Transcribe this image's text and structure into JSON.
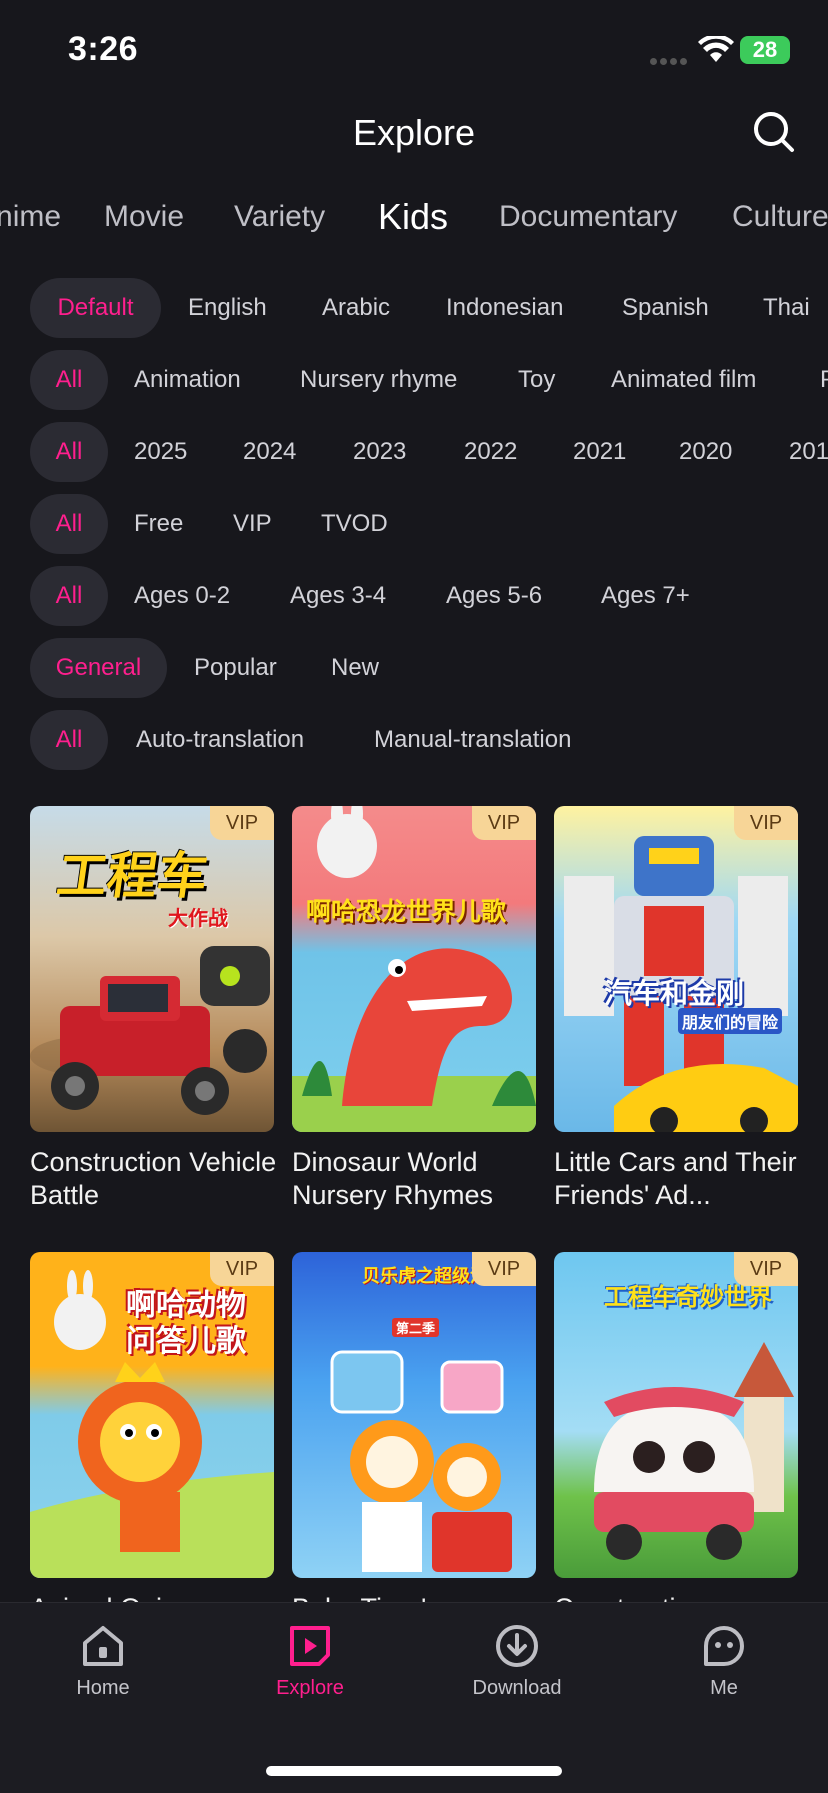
{
  "status": {
    "time": "3:26",
    "battery": "28"
  },
  "header": {
    "title": "Explore",
    "search_icon": "search-icon"
  },
  "categories": [
    "Anime",
    "Movie",
    "Variety",
    "Kids",
    "Documentary",
    "Culture"
  ],
  "active_category": "Kids",
  "filters": {
    "language": [
      "Default",
      "English",
      "Arabic",
      "Indonesian",
      "Spanish",
      "Thai"
    ],
    "genre": [
      "All",
      "Animation",
      "Nursery rhyme",
      "Toy",
      "Animated film",
      "P"
    ],
    "year": [
      "All",
      "2025",
      "2024",
      "2023",
      "2022",
      "2021",
      "2020",
      "201"
    ],
    "pricing": [
      "All",
      "Free",
      "VIP",
      "TVOD"
    ],
    "age": [
      "All",
      "Ages 0-2",
      "Ages 3-4",
      "Ages 5-6",
      "Ages 7+"
    ],
    "sort": [
      "General",
      "Popular",
      "New"
    ],
    "translation": [
      "All",
      "Auto-translation",
      "Manual-translation"
    ]
  },
  "badge_vip": "VIP",
  "cards": [
    {
      "title": "Construction Vehicle Battle",
      "poster_text": "工程车",
      "poster_sub": "大作战"
    },
    {
      "title": "Dinosaur World Nursery Rhymes",
      "poster_text": "啊哈恐龙世界儿歌"
    },
    {
      "title": "Little Cars and Their Friends' Ad...",
      "poster_text": "汽车和金刚",
      "poster_sub": "朋友们的冒险"
    },
    {
      "title": "Animal Quiz",
      "poster_text": "啊哈动物问答儿歌"
    },
    {
      "title": "Baby Tiger's",
      "poster_text": "贝乐虎之超级汽车",
      "poster_sub": "第二季"
    },
    {
      "title": "Construction",
      "poster_text": "工程车奇妙世界"
    }
  ],
  "tabbar": [
    {
      "label": "Home",
      "icon": "home-icon"
    },
    {
      "label": "Explore",
      "icon": "explore-icon"
    },
    {
      "label": "Download",
      "icon": "download-icon"
    },
    {
      "label": "Me",
      "icon": "me-icon"
    }
  ],
  "colors": {
    "accent": "#ff1f8e",
    "background": "#17171c",
    "vip": "#f7d597"
  }
}
